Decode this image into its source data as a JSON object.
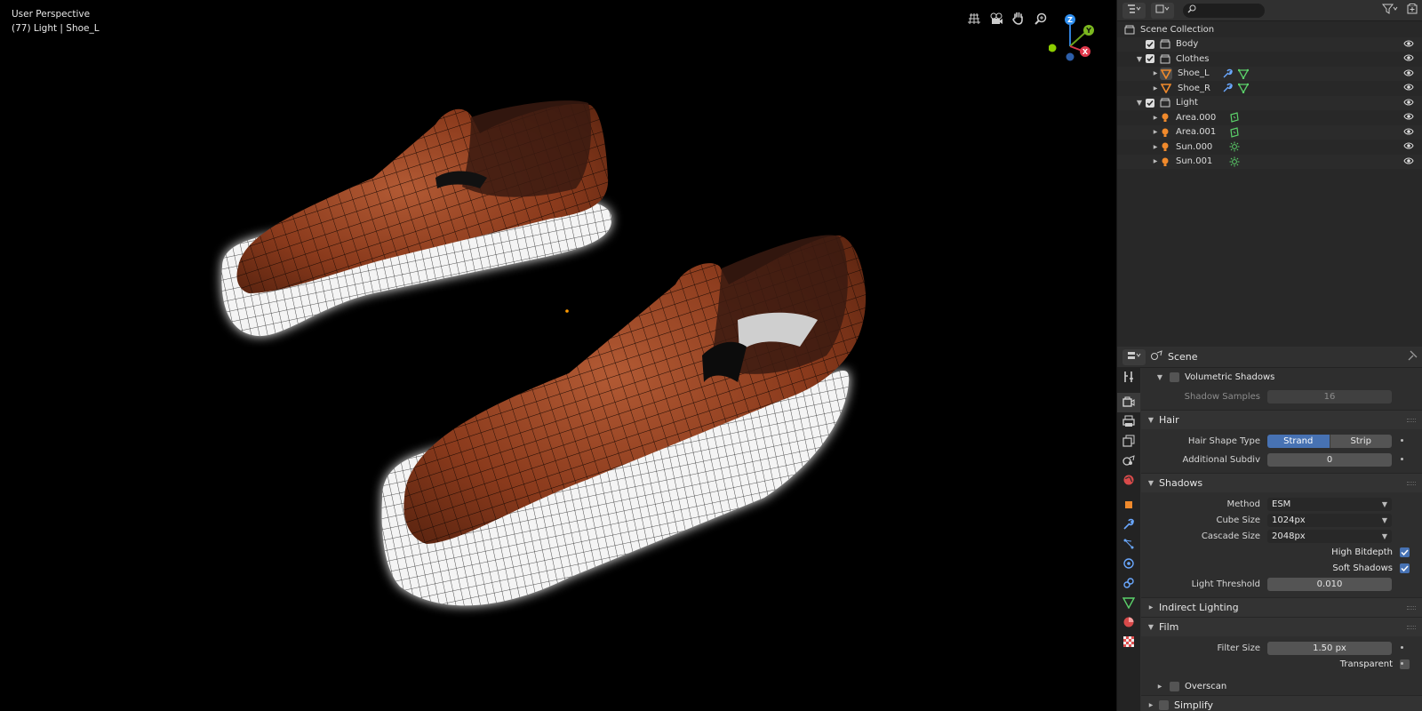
{
  "viewport": {
    "title": "User Perspective",
    "subtitle": "(77) Light | Shoe_L",
    "gizmo": {
      "z": "Z",
      "y": "Y",
      "x": "X"
    }
  },
  "outliner": {
    "root": "Scene Collection",
    "items": [
      {
        "label": "Body",
        "kind": "collection"
      },
      {
        "label": "Clothes",
        "kind": "collection"
      },
      {
        "label": "Shoe_L",
        "kind": "mesh"
      },
      {
        "label": "Shoe_R",
        "kind": "mesh"
      },
      {
        "label": "Light",
        "kind": "collection"
      },
      {
        "label": "Area.000",
        "kind": "light"
      },
      {
        "label": "Area.001",
        "kind": "light"
      },
      {
        "label": "Sun.000",
        "kind": "sun"
      },
      {
        "label": "Sun.001",
        "kind": "sun"
      }
    ]
  },
  "properties": {
    "context": "Scene",
    "volumetric_shadows": "Volumetric Shadows",
    "shadow_samples_label": "Shadow Samples",
    "shadow_samples_value": "16",
    "hair": {
      "title": "Hair",
      "shape_type_label": "Hair Shape Type",
      "strand": "Strand",
      "strip": "Strip",
      "subdiv_label": "Additional Subdiv",
      "subdiv_value": "0"
    },
    "shadows": {
      "title": "Shadows",
      "method_label": "Method",
      "method_value": "ESM",
      "cube_label": "Cube Size",
      "cube_value": "1024px",
      "cascade_label": "Cascade Size",
      "cascade_value": "2048px",
      "high_bitdepth": "High Bitdepth",
      "soft_shadows": "Soft Shadows",
      "threshold_label": "Light Threshold",
      "threshold_value": "0.010"
    },
    "indirect": "Indirect Lighting",
    "film": {
      "title": "Film",
      "filter_label": "Filter Size",
      "filter_value": "1.50 px",
      "transparent": "Transparent"
    },
    "overscan": "Overscan",
    "simplify": "Simplify"
  },
  "colors": {
    "accent": "#4772b3",
    "leather": "#8a3a1c",
    "sole": "#f2f2f2"
  }
}
